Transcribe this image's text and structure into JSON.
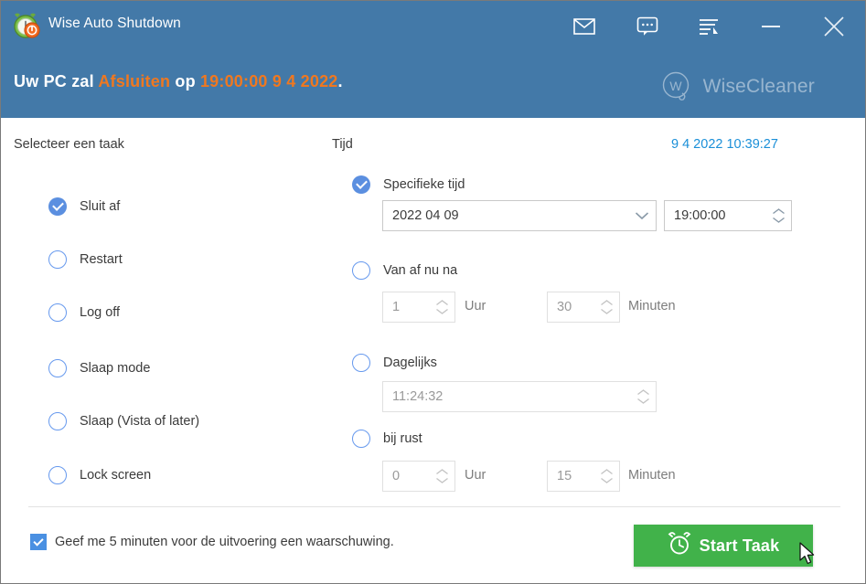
{
  "window": {
    "app_title": "Wise Auto Shutdown",
    "app_icon": "alarm-clock-icon"
  },
  "titlebar": {
    "buttons": [
      {
        "name": "mail-icon",
        "tooltip": "Mail"
      },
      {
        "name": "feedback-icon",
        "tooltip": "Feedback"
      },
      {
        "name": "menu-icon",
        "tooltip": "Menu"
      },
      {
        "name": "minimize-icon",
        "tooltip": "Minimize"
      },
      {
        "name": "close-icon",
        "tooltip": "Close"
      }
    ]
  },
  "banner": {
    "prefix": "Uw PC zal ",
    "action": "Afsluiten",
    "middle": " op ",
    "time": "19:00:00 9 4 2022",
    "suffix": ".",
    "brand_name": "WiseCleaner",
    "brand_mark_letter": "W"
  },
  "task_panel": {
    "label": "Selecteer een taak",
    "options": [
      {
        "label": "Sluit af",
        "selected": true
      },
      {
        "label": "Restart",
        "selected": false
      },
      {
        "label": "Log off",
        "selected": false
      },
      {
        "label": "Slaap mode",
        "selected": false
      },
      {
        "label": "Slaap (Vista of later)",
        "selected": false
      },
      {
        "label": "Lock screen",
        "selected": false
      }
    ]
  },
  "time_panel": {
    "label": "Tijd",
    "current_datetime": "9 4 2022 10:39:27",
    "modes": [
      {
        "label": "Specifieke tijd",
        "selected": true
      },
      {
        "label": "Van af nu na",
        "selected": false
      },
      {
        "label": "Dagelijks",
        "selected": false
      },
      {
        "label": "bij rust",
        "selected": false
      }
    ],
    "specific": {
      "date_value": "2022 04 09",
      "time_value": "19:00:00"
    },
    "from_now": {
      "hours_value": "1",
      "hours_unit": "Uur",
      "minutes_value": "30",
      "minutes_unit": "Minuten"
    },
    "daily": {
      "time_value": "11:24:32"
    },
    "on_idle": {
      "hours_value": "0",
      "hours_unit": "Uur",
      "minutes_value": "15",
      "minutes_unit": "Minuten"
    }
  },
  "footer": {
    "warning_checkbox_label": "Geef me 5 minuten voor de uitvoering een waarschuwing.",
    "warning_checked": true,
    "start_button_label": "Start Taak",
    "start_button_icon": "alarm-clock-icon"
  },
  "colors": {
    "header_blue": "#4379a8",
    "accent_orange": "#ef7820",
    "link_blue": "#1a8fd8",
    "radio_blue": "#5b8fe0",
    "start_green": "#41b24a"
  }
}
